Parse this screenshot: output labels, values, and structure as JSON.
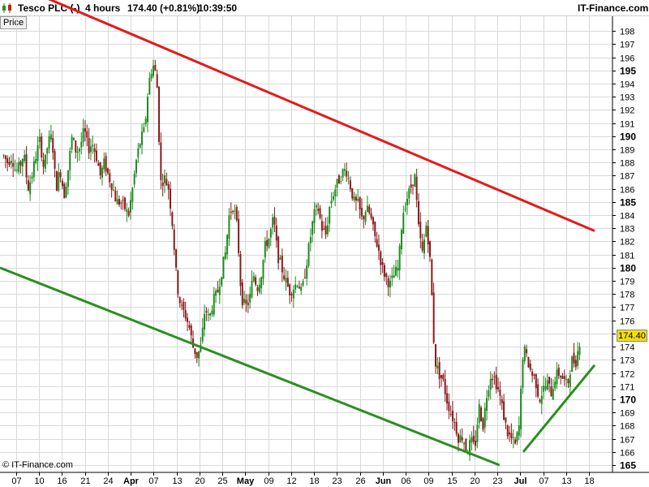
{
  "header": {
    "symbol": "Tesco PLC (-)",
    "interval": "4 hours",
    "price_change": "174.40 (+0.81%)",
    "time": "10:39:50",
    "brand": "IT-Finance.com"
  },
  "price_tab_label": "Price",
  "last_price_label": "174.40",
  "copyright": "© IT-Finance.com",
  "colors": {
    "up_candle": "#1e8c1e",
    "down_candle": "#8b1a1a",
    "resistance_line": "#e31b1b",
    "support_line": "#2a8f1f",
    "last_price_badge": "#f5e000",
    "grid": "#d9d9d9"
  },
  "chart_data": {
    "type": "candlestick",
    "title": "Tesco PLC (-)",
    "y_axis": {
      "position": "right",
      "range": [
        165,
        198.5
      ],
      "ticks": [
        165,
        166,
        167,
        168,
        169,
        170,
        171,
        172,
        173,
        174,
        175,
        176,
        177,
        178,
        179,
        180,
        181,
        182,
        183,
        184,
        185,
        186,
        187,
        188,
        189,
        190,
        191,
        192,
        193,
        194,
        195,
        196,
        197,
        198
      ],
      "major_ticks": [
        165,
        170,
        175,
        180,
        185,
        190,
        195
      ]
    },
    "x_axis": {
      "ticks": [
        {
          "label": "07",
          "major": false
        },
        {
          "label": "10",
          "major": false
        },
        {
          "label": "16",
          "major": false
        },
        {
          "label": "21",
          "major": false
        },
        {
          "label": "24",
          "major": false
        },
        {
          "label": "Apr",
          "major": true
        },
        {
          "label": "07",
          "major": false
        },
        {
          "label": "13",
          "major": false
        },
        {
          "label": "20",
          "major": false
        },
        {
          "label": "25",
          "major": false
        },
        {
          "label": "May",
          "major": true
        },
        {
          "label": "09",
          "major": false
        },
        {
          "label": "12",
          "major": false
        },
        {
          "label": "18",
          "major": false
        },
        {
          "label": "23",
          "major": false
        },
        {
          "label": "26",
          "major": false
        },
        {
          "label": "Jun",
          "major": true
        },
        {
          "label": "06",
          "major": false
        },
        {
          "label": "09",
          "major": false
        },
        {
          "label": "15",
          "major": false
        },
        {
          "label": "20",
          "major": false
        },
        {
          "label": "23",
          "major": false
        },
        {
          "label": "Jul",
          "major": true
        },
        {
          "label": "07",
          "major": false
        },
        {
          "label": "13",
          "major": false
        },
        {
          "label": "18",
          "major": false
        }
      ]
    },
    "close_path": [
      188.5,
      188.0,
      188.5,
      187.3,
      187.7,
      188.7,
      186.0,
      187.0,
      188.5,
      189.7,
      187.5,
      189.5,
      190.0,
      186.0,
      187.5,
      185.5,
      187.5,
      190.0,
      188.8,
      189.2,
      190.5,
      189.0,
      189.5,
      188.5,
      187.0,
      188.0,
      187.0,
      186.2,
      185.0,
      185.0,
      184.6,
      184.0,
      186.0,
      188.3,
      189.7,
      190.5,
      194.0,
      195.5,
      194.5,
      186.5,
      186.8,
      186.0,
      183.0,
      178.8,
      177.0,
      176.5,
      175.6,
      174.0,
      173.3,
      174.0,
      177.0,
      176.0,
      177.5,
      178.0,
      179.6,
      181.0,
      184.0,
      184.8,
      183.0,
      177.8,
      177.0,
      177.5,
      179.5,
      178.5,
      179.6,
      181.8,
      182.3,
      183.8,
      181.0,
      180.0,
      179.0,
      178.2,
      178.5,
      179.0,
      178.0,
      180.0,
      182.0,
      184.0,
      184.6,
      183.0,
      182.5,
      184.8,
      185.8,
      186.5,
      187.2,
      187.5,
      186.3,
      185.0,
      184.8,
      183.6,
      184.5,
      184.0,
      182.5,
      181.5,
      180.0,
      179.2,
      178.7,
      179.5,
      180.0,
      184.0,
      185.2,
      186.0,
      187.2,
      183.0,
      181.0,
      183.5,
      180.0,
      173.0,
      172.0,
      171.5,
      170.0,
      169.0,
      168.2,
      167.0,
      167.2,
      166.0,
      166.8,
      166.3,
      169.5,
      168.0,
      170.5,
      172.0,
      171.5,
      170.5,
      169.0,
      167.5,
      167.0,
      166.5,
      168.0,
      174.0,
      173.0,
      172.0,
      171.5,
      170.0,
      170.8,
      171.2,
      170.5,
      171.8,
      172.0,
      171.5,
      171.0,
      173.0,
      172.8,
      174.4
    ],
    "series": [
      {
        "name": "",
        "kind": "trendline",
        "color": "red",
        "points": [
          [
            0.0,
            202.0
          ],
          [
            1.0,
            182.8
          ]
        ]
      },
      {
        "name": "",
        "kind": "trendline",
        "color": "green",
        "points": [
          [
            0.0,
            180.0
          ],
          [
            0.84,
            165.0
          ]
        ]
      },
      {
        "name": "",
        "kind": "trendline",
        "color": "green",
        "points": [
          [
            0.88,
            166.0
          ],
          [
            1.0,
            172.6
          ]
        ]
      }
    ],
    "last_price": 174.4,
    "grid": true
  }
}
